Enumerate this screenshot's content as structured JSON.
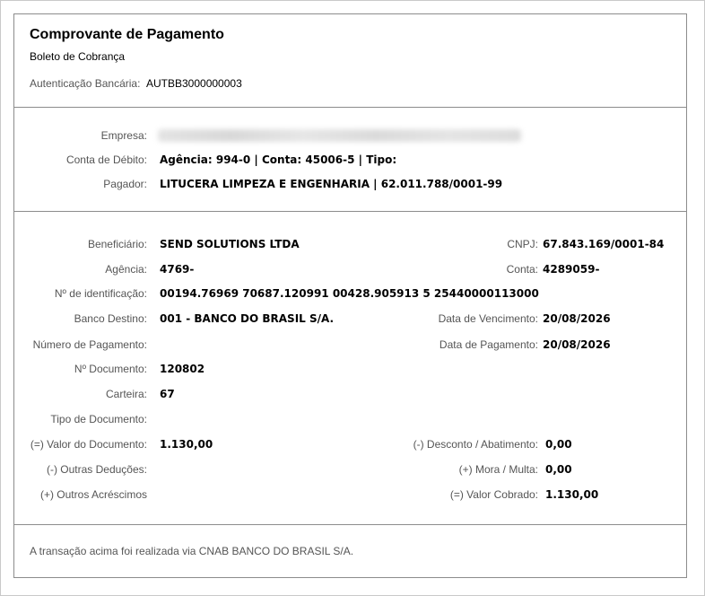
{
  "header": {
    "title": "Comprovante de Pagamento",
    "subtitle": "Boleto de Cobrança",
    "auth_label": "Autenticação Bancária:",
    "auth_value": "AUTBB3000000003"
  },
  "company": {
    "empresa_label": "Empresa:",
    "conta_label": "Conta de Débito:",
    "conta_value": "Agência: 994-0  |  Conta: 45006-5  |  Tipo:",
    "pagador_label": "Pagador:",
    "pagador_value": "LITUCERA LIMPEZA E ENGENHARIA  |  62.011.788/0001-99"
  },
  "details": {
    "beneficiario_label": "Beneficiário:",
    "beneficiario_value": "SEND SOLUTIONS LTDA",
    "cnpj_label": "CNPJ:",
    "cnpj_value": "67.843.169/0001-84",
    "agencia_label": "Agência:",
    "agencia_value": "4769-",
    "conta_label": "Conta:",
    "conta_value": "4289059-",
    "ident_label": "Nº de identificação:",
    "ident_value": "00194.76969 70687.120991 00428.905913 5 25440000113000",
    "banco_label": "Banco Destino:",
    "banco_value": "001 - BANCO DO BRASIL S/A.",
    "vencimento_label": "Data de Vencimento:",
    "vencimento_value": "20/08/2026",
    "numero_pag_label": "Número de Pagamento:",
    "data_pag_label": "Data de Pagamento:",
    "data_pag_value": "20/08/2026",
    "documento_label": "Nº Documento:",
    "documento_value": "120802",
    "carteira_label": "Carteira:",
    "carteira_value": "67",
    "tipo_doc_label": "Tipo de Documento:",
    "valor_doc_label": "(=) Valor do Documento:",
    "valor_doc_value": "1.130,00",
    "desconto_label": "(-) Desconto / Abatimento:",
    "desconto_value": "0,00",
    "outras_ded_label": "(-) Outras Deduções:",
    "mora_label": "(+) Mora / Multa:",
    "mora_value": "0,00",
    "outros_acr_label": "(+) Outros Acréscimos",
    "valor_cobrado_label": "(=) Valor Cobrado:",
    "valor_cobrado_value": "1.130,00"
  },
  "footer": {
    "text": "A transação acima foi realizada via CNAB BANCO DO BRASIL S/A."
  }
}
